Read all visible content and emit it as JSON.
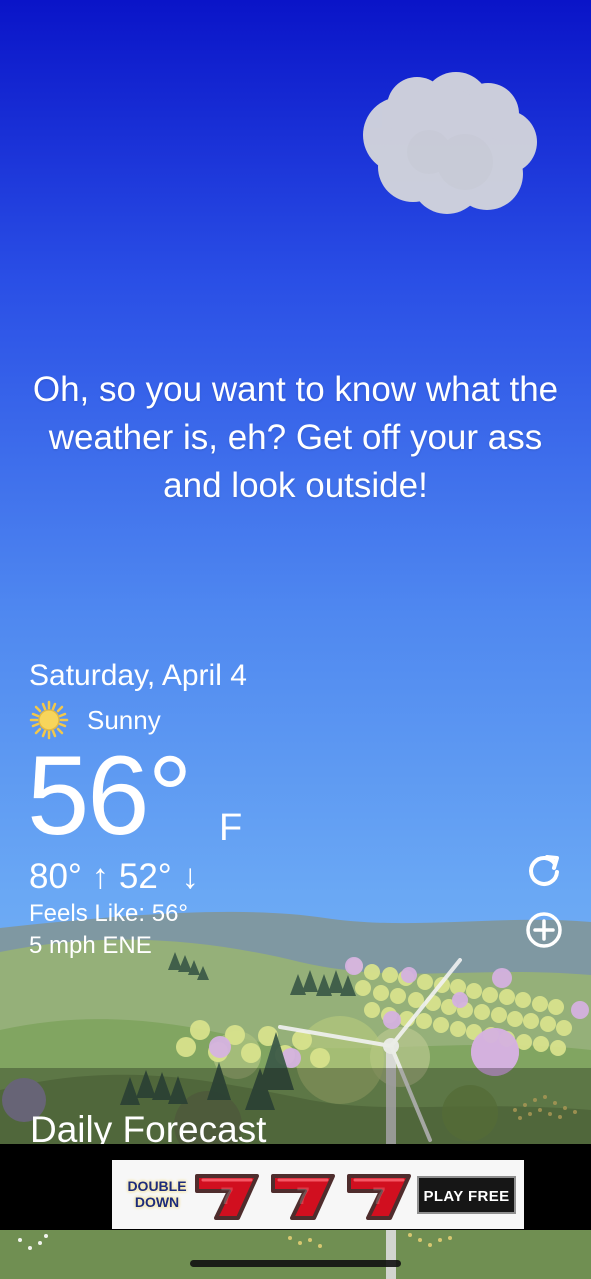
{
  "weather": {
    "quote": "Oh, so you want to know what the weather is, eh? Get off your ass and look outside!",
    "date": "Saturday, April 4",
    "condition": "Sunny",
    "temperature": "56°",
    "unit": "F",
    "hilo": "80° ↑ 52° ↓",
    "feels_like": "Feels Like: 56°",
    "wind": "5 mph ENE"
  },
  "sections": {
    "daily_forecast": "Daily Forecast"
  },
  "ad": {
    "brand_line_1": "DOUBLE",
    "brand_line_2": "DOWN",
    "symbol_1": "7",
    "symbol_2": "7",
    "symbol_3": "7",
    "cta": "PLAY FREE"
  },
  "icons": {
    "condition": "sun-icon",
    "refresh": "refresh-icon",
    "add": "add-circle-icon"
  },
  "colors": {
    "sky_top": "#0a14c8",
    "sky_bottom": "#84bdf2",
    "text": "#ffffff",
    "ad_background": "#f7f7f7",
    "seven_red": "#d10f1f"
  }
}
